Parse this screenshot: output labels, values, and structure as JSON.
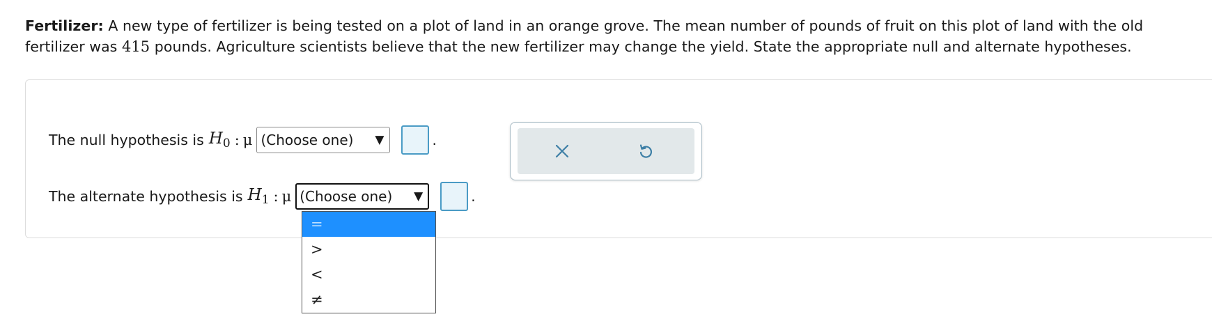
{
  "question": {
    "label": "Fertilizer:",
    "text_part1": " A new type of fertilizer is being tested on a plot of land in an orange grove. The mean number of pounds of fruit on this plot of land with the old fertilizer was ",
    "value": "415",
    "text_part2": " pounds. Agriculture scientists believe that the new fertilizer may change the yield. State the appropriate null and alternate hypotheses."
  },
  "null_row": {
    "label": "The null hypothesis is",
    "symbol": "H",
    "subscript": "0",
    "colon": ":",
    "mu": "μ",
    "select_value": "(Choose one)",
    "period": "."
  },
  "alt_row": {
    "label": "The alternate hypothesis is",
    "symbol": "H",
    "subscript": "1",
    "colon": ":",
    "mu": "μ",
    "select_value": "(Choose one)",
    "period": "."
  },
  "caret": "▼",
  "dropdown_options": [
    "=",
    ">",
    "<",
    "≠"
  ],
  "selected_option_index": 0,
  "tools": {
    "clear_icon": "x-icon",
    "undo_icon": "undo-icon"
  },
  "colors": {
    "accent_box_border": "#4a9bc5",
    "accent_box_fill": "#e8f4fa",
    "selected_option_bg": "#1e90ff",
    "tool_panel_bg": "#e2e8ea",
    "icon_color": "#3d7fa6"
  }
}
